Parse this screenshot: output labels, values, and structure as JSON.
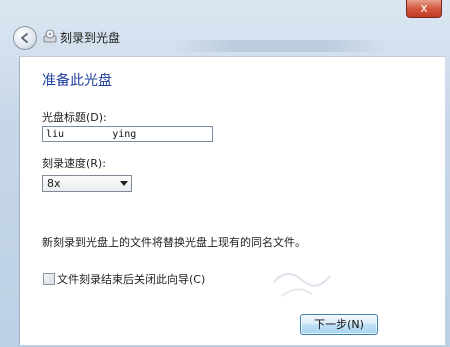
{
  "window": {
    "title": "刻录到光盘",
    "close_label": "x",
    "back_icon": "back-arrow-icon",
    "title_icon": "disc-burn-icon"
  },
  "main": {
    "heading": "准备此光盘",
    "disc_title_label": "光盘标题(D):",
    "disc_title_value": "liu        ying",
    "speed_label": "刻录速度(R):",
    "speed_value": "8x",
    "notice": "新刻录到光盘上的文件将替换光盘上现有的同名文件。",
    "close_wizard_label": "文件刻录结束后关闭此向导(C)",
    "close_wizard_checked": false
  },
  "footer": {
    "next_label": "下一步(N)"
  },
  "colors": {
    "heading": "#1f3f9c",
    "frame": "#c8d7e8",
    "close_button": "#c13b22"
  }
}
